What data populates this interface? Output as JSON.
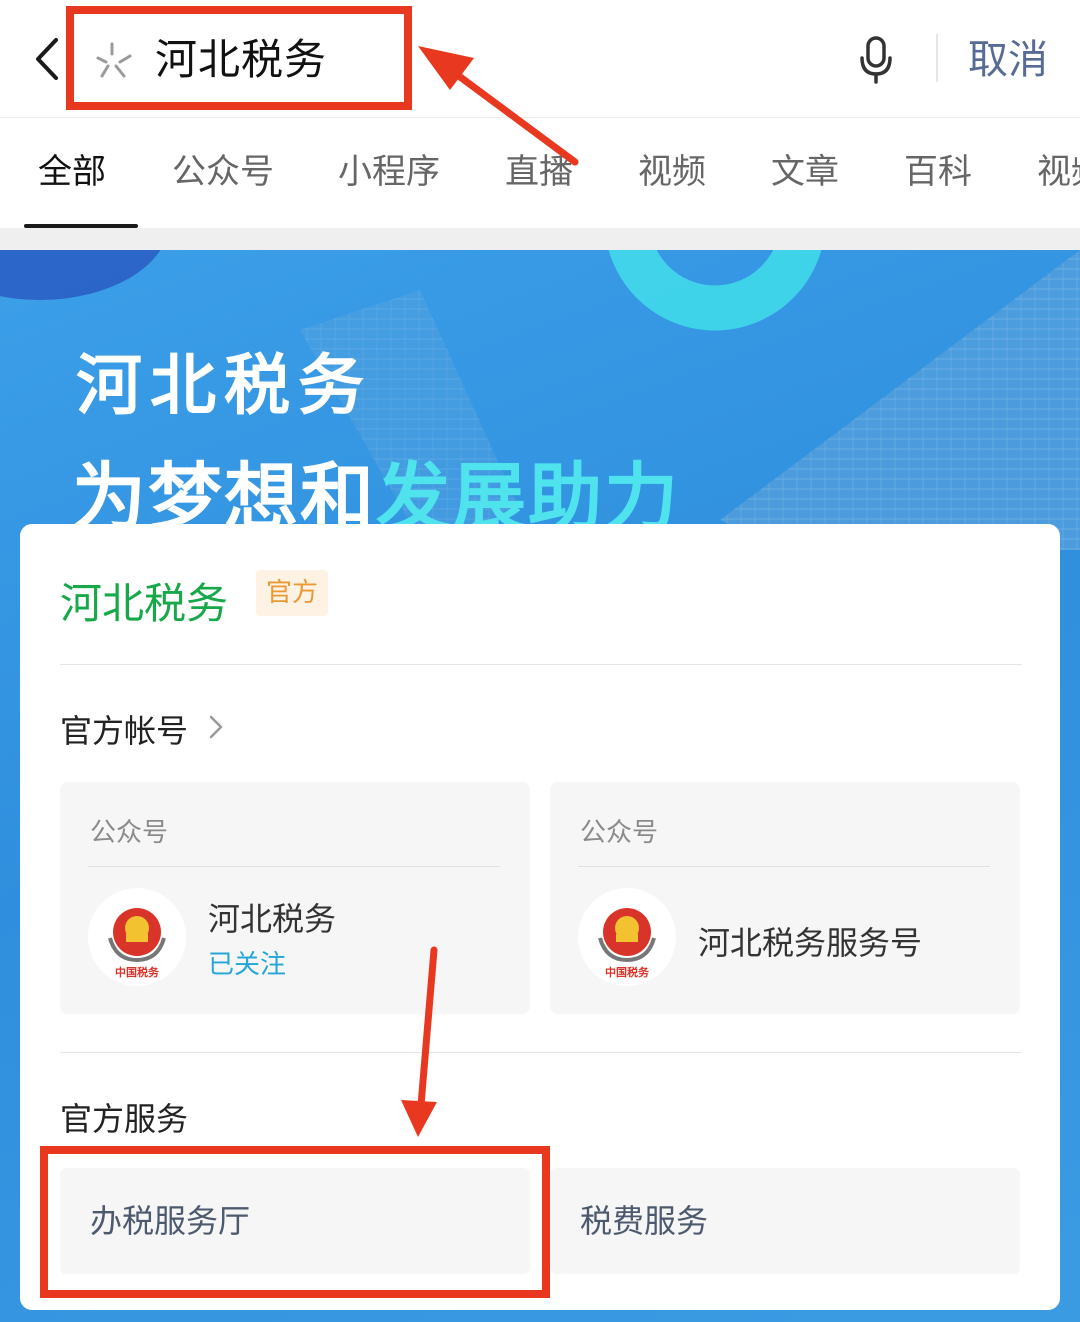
{
  "search": {
    "query": "河北税务",
    "cancel_label": "取消"
  },
  "tabs": [
    {
      "label": "全部",
      "active": true
    },
    {
      "label": "公众号"
    },
    {
      "label": "小程序"
    },
    {
      "label": "直播"
    },
    {
      "label": "视频"
    },
    {
      "label": "文章"
    },
    {
      "label": "百科"
    },
    {
      "label": "视频"
    }
  ],
  "banner": {
    "title": "河北税务",
    "slogan_part1": "为梦想和",
    "slogan_part2": "发展助力"
  },
  "card": {
    "brand_name": "河北税务",
    "badge": "官方",
    "accounts_title": "官方帐号",
    "accounts": [
      {
        "type": "公众号",
        "name": "河北税务",
        "status": "已关注",
        "avatar_text": "中国税务"
      },
      {
        "type": "公众号",
        "name": "河北税务服务号",
        "avatar_text": "中国税务"
      }
    ],
    "services_title": "官方服务",
    "services": [
      {
        "label": "办税服务厅"
      },
      {
        "label": "税费服务"
      }
    ]
  },
  "colors": {
    "brand_green": "#17a84a",
    "link_blue": "#576b95",
    "annotation_red": "#e8381f"
  }
}
